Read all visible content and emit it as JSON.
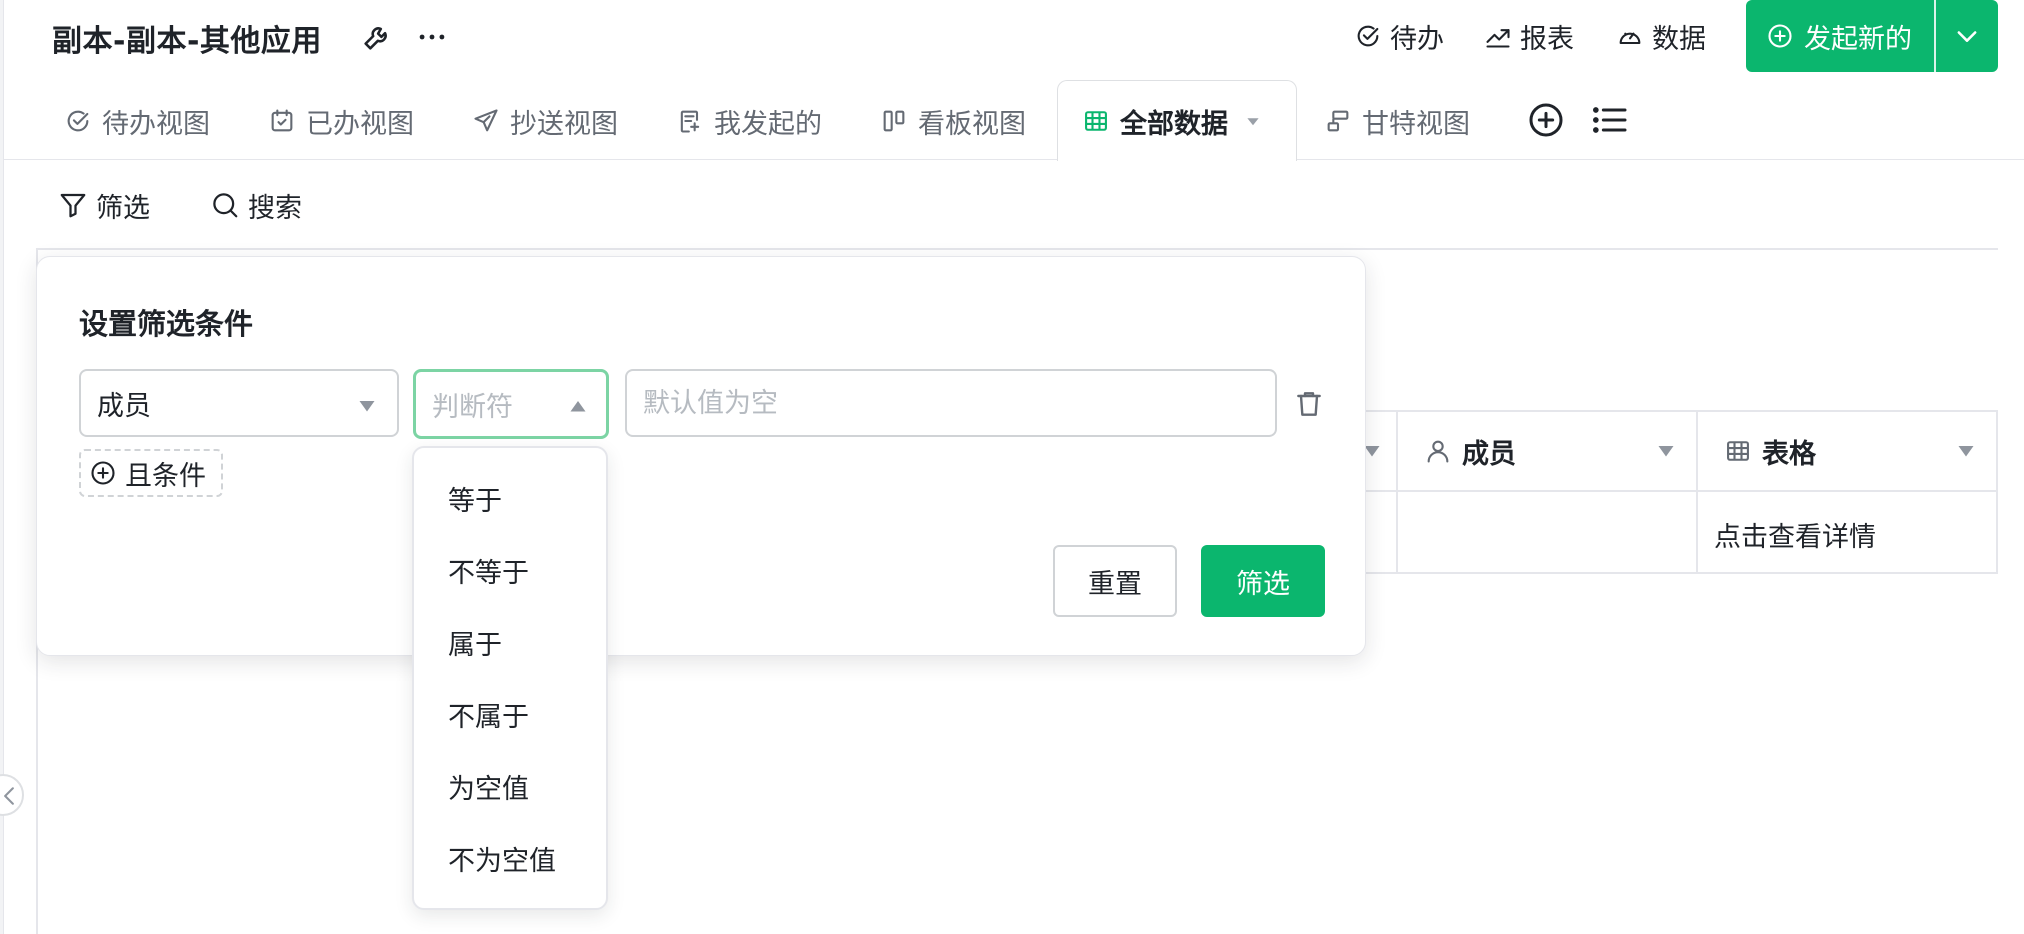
{
  "app": {
    "title": "副本-副本-其他应用"
  },
  "header": {
    "todo_label": "待办",
    "report_label": "报表",
    "data_label": "数据",
    "create_label": "发起新的"
  },
  "tabs": [
    {
      "label": "待办视图",
      "icon": "check-circle-icon"
    },
    {
      "label": "已办视图",
      "icon": "calendar-check-icon"
    },
    {
      "label": "抄送视图",
      "icon": "send-icon"
    },
    {
      "label": "我发起的",
      "icon": "edit-doc-icon"
    },
    {
      "label": "看板视图",
      "icon": "kanban-icon"
    },
    {
      "label": "全部数据",
      "icon": "table-grid-icon",
      "active": true
    },
    {
      "label": "甘特视图",
      "icon": "gantt-icon"
    }
  ],
  "toolbar": {
    "filter_label": "筛选",
    "search_label": "搜索"
  },
  "table": {
    "columns": [
      {
        "label": "成员",
        "icon": "person-icon"
      },
      {
        "label": "表格",
        "icon": "table-icon"
      }
    ],
    "rows": [
      {
        "member": "",
        "table": "点击查看详情"
      }
    ]
  },
  "filter_panel": {
    "title": "设置筛选条件",
    "field_value": "成员",
    "operator_placeholder": "判断符",
    "value_placeholder": "默认值为空",
    "and_label": "且条件",
    "reset_label": "重置",
    "apply_label": "筛选"
  },
  "operator_options": [
    "等于",
    "不等于",
    "属于",
    "不属于",
    "为空值",
    "不为空值"
  ],
  "colors": {
    "accent": "#0bb66e",
    "focus_border": "#7cd4a4"
  }
}
